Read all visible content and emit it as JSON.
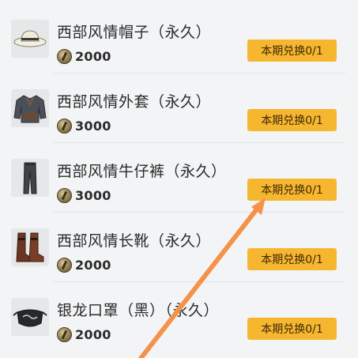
{
  "items": [
    {
      "name": "西部风情帽子（永久）",
      "price": "2000",
      "button_label": "本期兑换0/1",
      "icon": "hat-icon"
    },
    {
      "name": "西部风情外套（永久）",
      "price": "3000",
      "button_label": "本期兑换0/1",
      "icon": "jacket-icon"
    },
    {
      "name": "西部风情牛仔裤（永久）",
      "price": "3000",
      "button_label": "本期兑换0/1",
      "icon": "jeans-icon"
    },
    {
      "name": "西部风情长靴（永久）",
      "price": "2000",
      "button_label": "本期兑换0/1",
      "icon": "boots-icon"
    },
    {
      "name": "银龙口罩（黑）（永久）",
      "price": "2000",
      "button_label": "本期兑换0/1",
      "icon": "mask-icon"
    }
  ],
  "colors": {
    "background": "#f3f4f6",
    "button": "#f7b62f",
    "arrow": "#f5924a"
  },
  "currency_icon": "coin-icon",
  "annotation_icon": "arrow-icon"
}
